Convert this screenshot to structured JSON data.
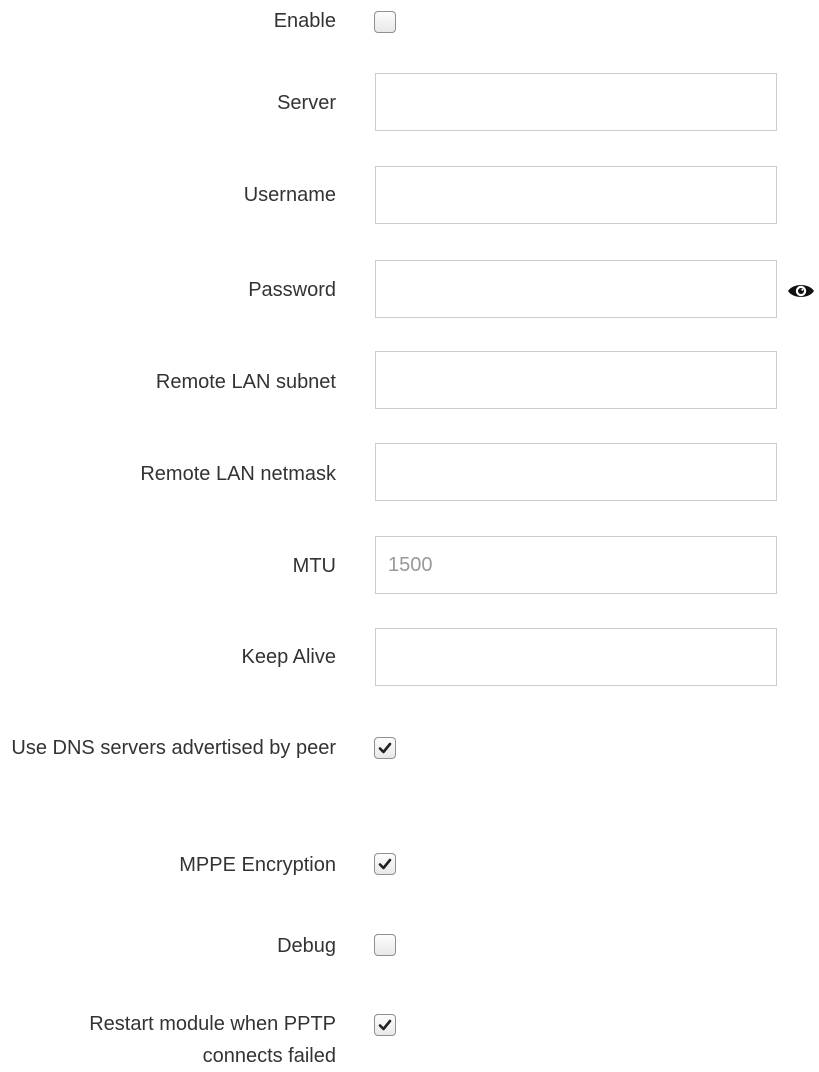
{
  "form": {
    "enable": {
      "label": "Enable",
      "checked": false
    },
    "server": {
      "label": "Server",
      "value": "",
      "placeholder": ""
    },
    "username": {
      "label": "Username",
      "value": "",
      "placeholder": ""
    },
    "password": {
      "label": "Password",
      "value": "",
      "placeholder": "",
      "reveal_icon": "eye-icon"
    },
    "remote_lan_subnet": {
      "label": "Remote LAN subnet",
      "value": "",
      "placeholder": ""
    },
    "remote_lan_netmask": {
      "label": "Remote LAN netmask",
      "value": "",
      "placeholder": ""
    },
    "mtu": {
      "label": "MTU",
      "value": "",
      "placeholder": "1500"
    },
    "keep_alive": {
      "label": "Keep Alive",
      "value": "",
      "placeholder": ""
    },
    "use_dns": {
      "label": "Use DNS servers advertised by peer",
      "checked": true
    },
    "mppe": {
      "label": "MPPE Encryption",
      "checked": true
    },
    "debug": {
      "label": "Debug",
      "checked": false
    },
    "restart_module": {
      "label": "Restart module when PPTP connects failed",
      "checked": true
    }
  },
  "colors": {
    "label_text": "#333333",
    "input_border": "#cccccc",
    "placeholder": "#999999",
    "checkmark": "#222222"
  }
}
